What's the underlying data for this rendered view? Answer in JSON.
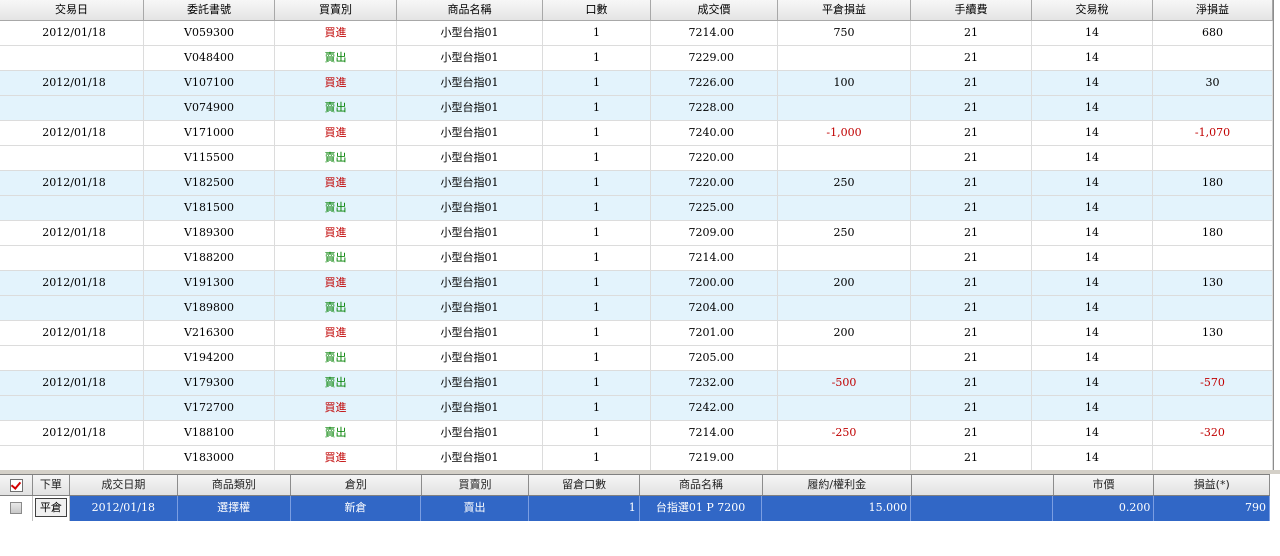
{
  "top_grid": {
    "columns": [
      "交易日",
      "委託書號",
      "買賣別",
      "商品名稱",
      "口數",
      "成交價",
      "平倉損益",
      "手續費",
      "交易稅",
      "淨損益"
    ],
    "rows": [
      {
        "date": "2012/01/18",
        "order": "V059300",
        "side": "買進",
        "product": "小型台指01",
        "qty": "1",
        "price": "7214.00",
        "pnl": "750",
        "fee": "21",
        "tax": "14",
        "net": "680"
      },
      {
        "date": "",
        "order": "V048400",
        "side": "賣出",
        "product": "小型台指01",
        "qty": "1",
        "price": "7229.00",
        "pnl": "",
        "fee": "21",
        "tax": "14",
        "net": ""
      },
      {
        "date": "2012/01/18",
        "order": "V107100",
        "side": "買進",
        "product": "小型台指01",
        "qty": "1",
        "price": "7226.00",
        "pnl": "100",
        "fee": "21",
        "tax": "14",
        "net": "30"
      },
      {
        "date": "",
        "order": "V074900",
        "side": "賣出",
        "product": "小型台指01",
        "qty": "1",
        "price": "7228.00",
        "pnl": "",
        "fee": "21",
        "tax": "14",
        "net": ""
      },
      {
        "date": "2012/01/18",
        "order": "V171000",
        "side": "買進",
        "product": "小型台指01",
        "qty": "1",
        "price": "7240.00",
        "pnl": "-1,000",
        "fee": "21",
        "tax": "14",
        "net": "-1,070"
      },
      {
        "date": "",
        "order": "V115500",
        "side": "賣出",
        "product": "小型台指01",
        "qty": "1",
        "price": "7220.00",
        "pnl": "",
        "fee": "21",
        "tax": "14",
        "net": ""
      },
      {
        "date": "2012/01/18",
        "order": "V182500",
        "side": "買進",
        "product": "小型台指01",
        "qty": "1",
        "price": "7220.00",
        "pnl": "250",
        "fee": "21",
        "tax": "14",
        "net": "180"
      },
      {
        "date": "",
        "order": "V181500",
        "side": "賣出",
        "product": "小型台指01",
        "qty": "1",
        "price": "7225.00",
        "pnl": "",
        "fee": "21",
        "tax": "14",
        "net": ""
      },
      {
        "date": "2012/01/18",
        "order": "V189300",
        "side": "買進",
        "product": "小型台指01",
        "qty": "1",
        "price": "7209.00",
        "pnl": "250",
        "fee": "21",
        "tax": "14",
        "net": "180"
      },
      {
        "date": "",
        "order": "V188200",
        "side": "賣出",
        "product": "小型台指01",
        "qty": "1",
        "price": "7214.00",
        "pnl": "",
        "fee": "21",
        "tax": "14",
        "net": ""
      },
      {
        "date": "2012/01/18",
        "order": "V191300",
        "side": "買進",
        "product": "小型台指01",
        "qty": "1",
        "price": "7200.00",
        "pnl": "200",
        "fee": "21",
        "tax": "14",
        "net": "130"
      },
      {
        "date": "",
        "order": "V189800",
        "side": "賣出",
        "product": "小型台指01",
        "qty": "1",
        "price": "7204.00",
        "pnl": "",
        "fee": "21",
        "tax": "14",
        "net": ""
      },
      {
        "date": "2012/01/18",
        "order": "V216300",
        "side": "買進",
        "product": "小型台指01",
        "qty": "1",
        "price": "7201.00",
        "pnl": "200",
        "fee": "21",
        "tax": "14",
        "net": "130"
      },
      {
        "date": "",
        "order": "V194200",
        "side": "賣出",
        "product": "小型台指01",
        "qty": "1",
        "price": "7205.00",
        "pnl": "",
        "fee": "21",
        "tax": "14",
        "net": ""
      },
      {
        "date": "2012/01/18",
        "order": "V179300",
        "side": "賣出",
        "product": "小型台指01",
        "qty": "1",
        "price": "7232.00",
        "pnl": "-500",
        "fee": "21",
        "tax": "14",
        "net": "-570"
      },
      {
        "date": "",
        "order": "V172700",
        "side": "買進",
        "product": "小型台指01",
        "qty": "1",
        "price": "7242.00",
        "pnl": "",
        "fee": "21",
        "tax": "14",
        "net": ""
      },
      {
        "date": "2012/01/18",
        "order": "V188100",
        "side": "賣出",
        "product": "小型台指01",
        "qty": "1",
        "price": "7214.00",
        "pnl": "-250",
        "fee": "21",
        "tax": "14",
        "net": "-320"
      },
      {
        "date": "",
        "order": "V183000",
        "side": "買進",
        "product": "小型台指01",
        "qty": "1",
        "price": "7219.00",
        "pnl": "",
        "fee": "21",
        "tax": "14",
        "net": ""
      }
    ]
  },
  "bottom_grid": {
    "columns": [
      "",
      "下單",
      "成交日期",
      "商品類別",
      "倉別",
      "買賣別",
      "留倉口數",
      "商品名稱",
      "履約/權利金",
      "",
      "市價",
      "損益(*)"
    ],
    "row": {
      "order_button": "平倉",
      "date": "2012/01/18",
      "category": "選擇權",
      "position": "新倉",
      "side": "賣出",
      "qty": "1",
      "product": "台指選01 P 7200",
      "strike_premium": "15.000",
      "market_price": "0.200",
      "pnl": "790"
    }
  },
  "colors": {
    "buy": "#c00000",
    "sell": "#008000",
    "negative": "#c00000",
    "alt_row": "#e3f3fc",
    "selected_row": "#3167c6"
  },
  "icons": [
    "select-all-checkbox-icon",
    "row-checkbox-icon"
  ]
}
